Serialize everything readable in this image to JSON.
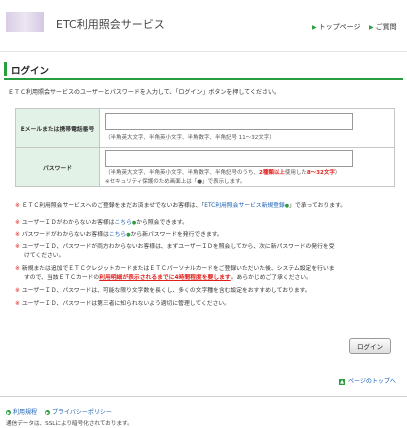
{
  "header": {
    "site_title": "ETC利用照会サービス",
    "nav": [
      {
        "label": "トップページ"
      },
      {
        "label": "ご質問"
      }
    ]
  },
  "page": {
    "title": "ログイン",
    "intro": "ＥＴＣ利用照会サービスのユーザーとパスワードを入力して、「ログイン」ボタンを押してください。"
  },
  "form": {
    "user_label": "Eメールまたは携帯電話番号",
    "user_value": "",
    "user_hint": "（半角英大文字、半角英小文字、半角数字、半角記号 11～32文字）",
    "pass_label": "パスワード",
    "pass_value": "",
    "pass_hint_a": "（半角英大文字、半角英小文字、半角数字、半角記号のうち、",
    "pass_hint_b": "2種類以上",
    "pass_hint_c": "使用した",
    "pass_hint_d": "8～32文字",
    "pass_hint_e": "）",
    "pass_hint2": "※セキュリティ保護のため画面上は「●」で表示します。"
  },
  "notes": {
    "mark": "※",
    "n1a": "ＥＴＣ利用照会サービスへのご登録をまだお済ませでないお客様は、「",
    "n1link": "ETC利用照会サービス新規登録",
    "n1b": "」で承っております。",
    "n2a": "ユーザーＩＤがわからないお客様は",
    "n2link": "こちら",
    "n2b": "から照会できます。",
    "n3a": "パスワードがわからないお客様は",
    "n3link": "こちら",
    "n3b": "から新パスワードを発行できます。",
    "n4a": "ユーザーＩＤ、パスワードが両方わからないお客様は、まずユーザーＩＤを照会してから、次に新パスワードの発行を受",
    "n4b": "けてください。",
    "n5a": "新規または追加でＥＴＣクレジットカードまたはＥＴＣパーソナルカードをご登録いただいた後、システム設定を行いま",
    "n5b": "すので、当該ＥＴＣカードの",
    "n5red": "利用明細が表示されるまでに4時間程度を要します",
    "n5c": "。あらかじめご了承ください。",
    "n6": "ユーザーＩＤ、パスワードは、可能な限り文字数を長くし、多くの文字種を含む設定をおすすめしております。",
    "n7": "ユーザーＩＤ、パスワードは第三者に知られないよう適切に管理してください。"
  },
  "login_button": "ログイン",
  "page_top": "ページのトップへ",
  "footer": {
    "links": [
      {
        "label": "利用規程"
      },
      {
        "label": "プライバシーポリシー"
      }
    ],
    "ssl": "通信データは、SSLにより暗号化されております。"
  },
  "colors": {
    "accent": "#2a9d3f",
    "link": "#1a5fb4",
    "alert": "#e0201c",
    "label_bg": "#e3f2e6"
  }
}
